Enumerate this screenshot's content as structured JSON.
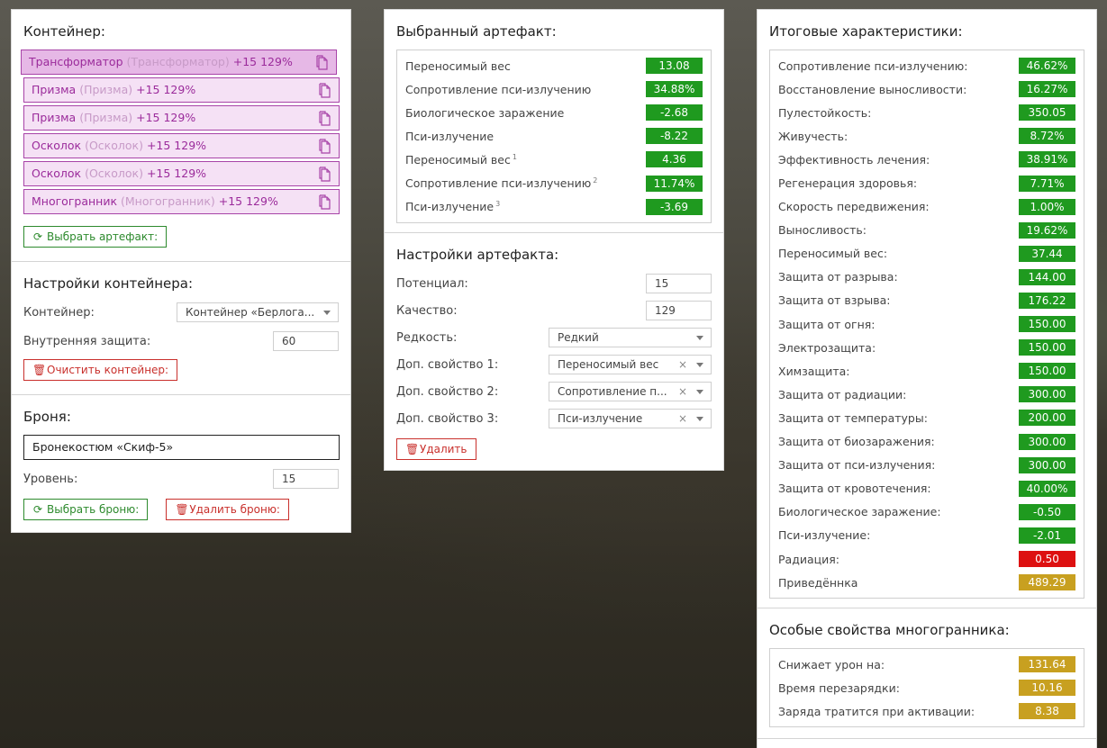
{
  "container": {
    "title": "Контейнер:",
    "items": [
      {
        "name": "Трансформатор",
        "orig": "(Трансформатор)",
        "bonus": "+15 129%"
      },
      {
        "name": "Призма",
        "orig": "(Призма)",
        "bonus": "+15 129%"
      },
      {
        "name": "Призма",
        "orig": "(Призма)",
        "bonus": "+15 129%"
      },
      {
        "name": "Осколок",
        "orig": "(Осколок)",
        "bonus": "+15 129%"
      },
      {
        "name": "Осколок",
        "orig": "(Осколок)",
        "bonus": "+15 129%"
      },
      {
        "name": "Многогранник",
        "orig": "(Многогранник)",
        "bonus": "+15 129%"
      }
    ],
    "select_button": "Выбрать артефакт:"
  },
  "container_settings": {
    "title": "Настройки контейнера:",
    "container_label": "Контейнер:",
    "container_value": "Контейнер «Берлога...",
    "protection_label": "Внутренняя защита:",
    "protection_value": "60",
    "clear_button": "Очистить контейнер:"
  },
  "armor": {
    "title": "Броня:",
    "name_value": "Бронекостюм «Скиф-5»",
    "level_label": "Уровень:",
    "level_value": "15",
    "select_button": "Выбрать броню:",
    "delete_button": "Удалить броню:"
  },
  "selected_artifact": {
    "title": "Выбранный артефакт:",
    "stats": [
      {
        "name": "Переносимый вес",
        "sup": "",
        "value": "13.08",
        "color": "green"
      },
      {
        "name": "Сопротивление пси-излучению",
        "sup": "",
        "value": "34.88%",
        "color": "green"
      },
      {
        "name": "Биологическое заражение",
        "sup": "",
        "value": "-2.68",
        "color": "green"
      },
      {
        "name": "Пси-излучение",
        "sup": "",
        "value": "-8.22",
        "color": "green"
      },
      {
        "name": "Переносимый вес",
        "sup": "1",
        "value": "4.36",
        "color": "green"
      },
      {
        "name": "Сопротивление пси-излучению",
        "sup": "2",
        "value": "11.74%",
        "color": "green"
      },
      {
        "name": "Пси-излучение",
        "sup": "3",
        "value": "-3.69",
        "color": "green"
      }
    ]
  },
  "artifact_settings": {
    "title": "Настройки артефакта:",
    "potential_label": "Потенциал:",
    "potential_value": "15",
    "quality_label": "Качество:",
    "quality_value": "129",
    "rarity_label": "Редкость:",
    "rarity_value": "Редкий",
    "prop1_label": "Доп. свойство 1:",
    "prop1_value": "Переносимый вес",
    "prop2_label": "Доп. свойство 2:",
    "prop2_value": "Сопротивление п...",
    "prop3_label": "Доп. свойство 3:",
    "prop3_value": "Пси-излучение",
    "delete_button": "Удалить"
  },
  "totals": {
    "title": "Итоговые характеристики:",
    "stats": [
      {
        "name": "Сопротивление пси-излучению:",
        "value": "46.62%",
        "color": "green"
      },
      {
        "name": "Восстановление выносливости:",
        "value": "16.27%",
        "color": "green"
      },
      {
        "name": "Пулестойкость:",
        "value": "350.05",
        "color": "green"
      },
      {
        "name": "Живучесть:",
        "value": "8.72%",
        "color": "green"
      },
      {
        "name": "Эффективность лечения:",
        "value": "38.91%",
        "color": "green"
      },
      {
        "name": "Регенерация здоровья:",
        "value": "7.71%",
        "color": "green"
      },
      {
        "name": "Скорость передвижения:",
        "value": "1.00%",
        "color": "green"
      },
      {
        "name": "Выносливость:",
        "value": "19.62%",
        "color": "green"
      },
      {
        "name": "Переносимый вес:",
        "value": "37.44",
        "color": "green"
      },
      {
        "name": "Защита от разрыва:",
        "value": "144.00",
        "color": "green"
      },
      {
        "name": "Защита от взрыва:",
        "value": "176.22",
        "color": "green"
      },
      {
        "name": "Защита от огня:",
        "value": "150.00",
        "color": "green"
      },
      {
        "name": "Электрозащита:",
        "value": "150.00",
        "color": "green"
      },
      {
        "name": "Химзащита:",
        "value": "150.00",
        "color": "green"
      },
      {
        "name": "Защита от радиации:",
        "value": "300.00",
        "color": "green"
      },
      {
        "name": "Защита от температуры:",
        "value": "200.00",
        "color": "green"
      },
      {
        "name": "Защита от биозаражения:",
        "value": "300.00",
        "color": "green"
      },
      {
        "name": "Защита от пси-излучения:",
        "value": "300.00",
        "color": "green"
      },
      {
        "name": "Защита от кровотечения:",
        "value": "40.00%",
        "color": "green"
      },
      {
        "name": "Биологическое заражение:",
        "value": "-0.50",
        "color": "green"
      },
      {
        "name": "Пси-излучение:",
        "value": "-2.01",
        "color": "green"
      },
      {
        "name": "Радиация:",
        "value": "0.50",
        "color": "red"
      },
      {
        "name": "Приведённка",
        "value": "489.29",
        "color": "gold"
      }
    ]
  },
  "polyhedron": {
    "title": "Особые свойства многогранника:",
    "stats": [
      {
        "name": "Снижает урон на:",
        "value": "131.64",
        "color": "gold"
      },
      {
        "name": "Время перезарядки:",
        "value": "10.16",
        "color": "gold"
      },
      {
        "name": "Заряда тратится при активации:",
        "value": "8.38",
        "color": "gold"
      }
    ]
  },
  "colors": {
    "green": "#1f9a1f",
    "red": "#dd1111",
    "gold": "#c8a020",
    "purple": "#9b2b9b"
  }
}
